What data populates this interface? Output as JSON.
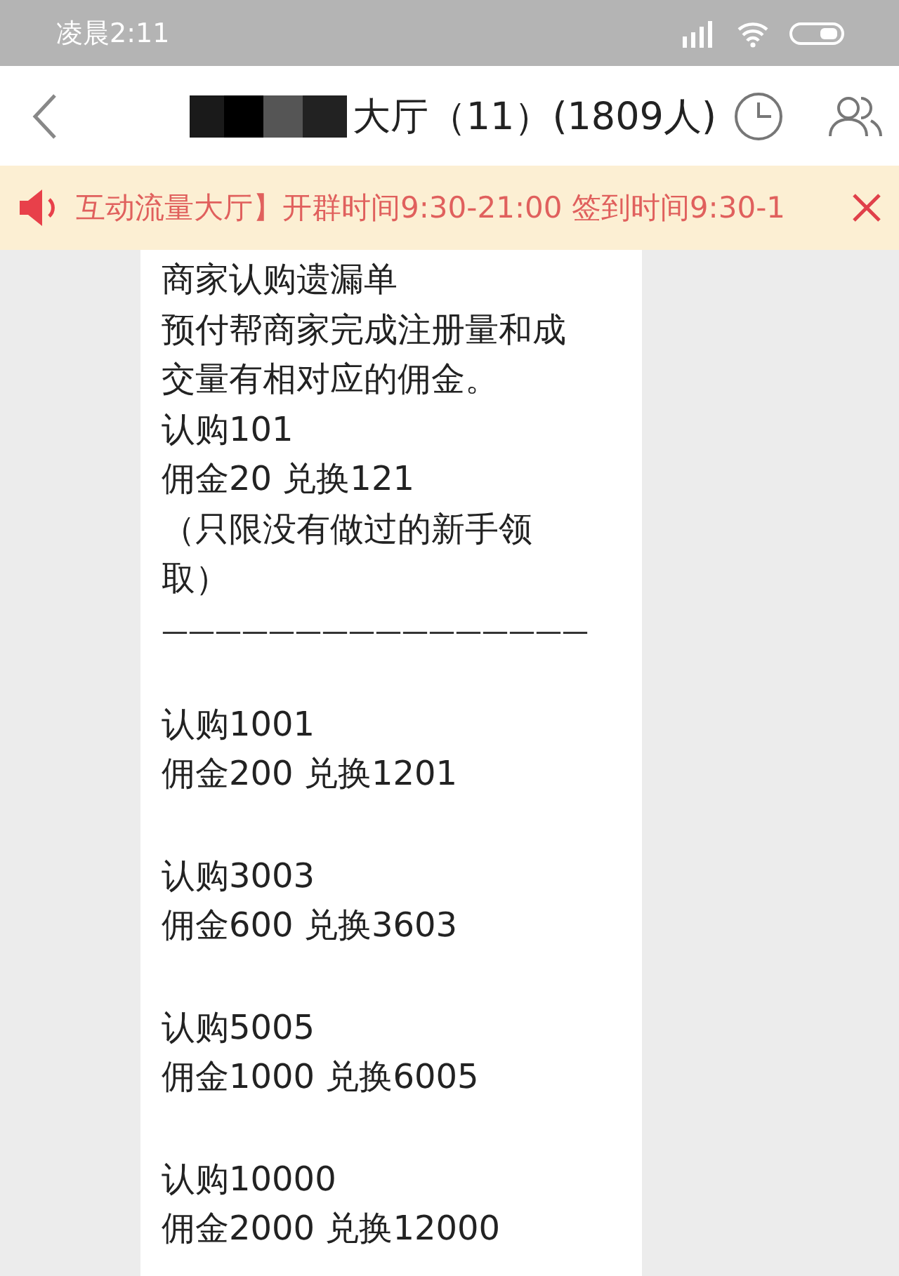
{
  "status_bar": {
    "time": "凌晨2:11"
  },
  "header": {
    "title": "大厅（11）(1809人)"
  },
  "banner": {
    "text": "互动流量大厅】开群时间9:30-21:00 签到时间9:30-1"
  },
  "message": {
    "paragraphs": [
      [
        "商家认购遗漏单",
        "预付帮商家完成注册量和成",
        "交量有相对应的佣金。",
        "认购101",
        "佣金20  兑换121",
        "（只限没有做过的新手领",
        "取）"
      ],
      "————————————————",
      [
        "认购1001",
        "佣金200 兑换1201"
      ],
      [
        "认购3003",
        "佣金600 兑换3603"
      ],
      [
        "认购5005",
        "佣金1000 兑换6005"
      ],
      [
        "认购10000",
        "佣金2000 兑换12000"
      ]
    ]
  }
}
